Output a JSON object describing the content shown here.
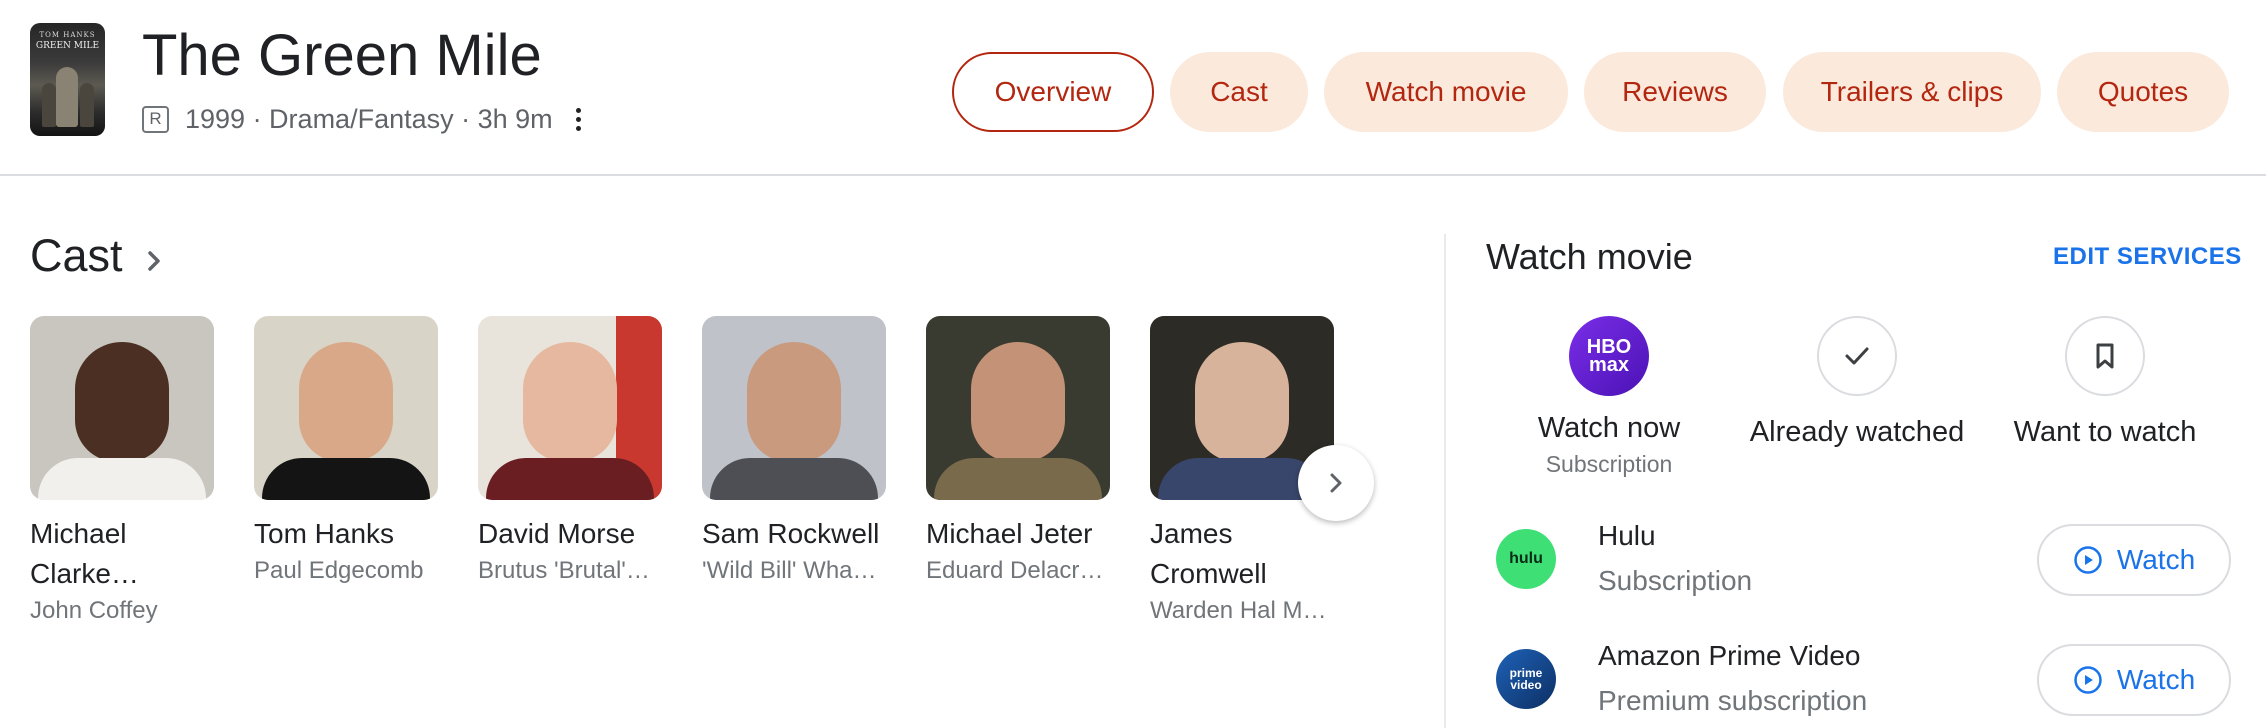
{
  "movie": {
    "title": "The Green Mile",
    "rating": "R",
    "meta": "1999 · Drama/Fantasy · 3h 9m",
    "poster_text_top": "TOM HANKS",
    "poster_text_title": "GREEN MILE"
  },
  "tabs": [
    {
      "label": "Overview",
      "active": true
    },
    {
      "label": "Cast",
      "active": false
    },
    {
      "label": "Watch movie",
      "active": false
    },
    {
      "label": "Reviews",
      "active": false
    },
    {
      "label": "Trailers & clips",
      "active": false
    },
    {
      "label": "Quotes",
      "active": false
    }
  ],
  "cast": {
    "heading": "Cast",
    "members": [
      {
        "name": "Michael Clarke…",
        "role": "John Coffey"
      },
      {
        "name": "Tom Hanks",
        "role": "Paul Edgecomb"
      },
      {
        "name": "David Morse",
        "role": "Brutus 'Brutal'…"
      },
      {
        "name": "Sam Rockwell",
        "role": "'Wild Bill' Wha…"
      },
      {
        "name": "Michael Jeter",
        "role": "Eduard Delacroix"
      },
      {
        "name": "James Cromwell",
        "role": "Warden Hal M…"
      }
    ]
  },
  "watch": {
    "heading": "Watch movie",
    "edit_label": "EDIT SERVICES",
    "hbo_logo": "HBO max",
    "options": [
      {
        "label": "Watch now",
        "sub": "Subscription"
      },
      {
        "label": "Already watched"
      },
      {
        "label": "Want to watch"
      }
    ],
    "providers": [
      {
        "name": "Hulu",
        "sub": "Subscription",
        "logo": "hulu",
        "button": "Watch"
      },
      {
        "name": "Amazon Prime Video",
        "sub": "Premium subscription",
        "logo": "prime video",
        "button": "Watch"
      }
    ]
  },
  "colors": {
    "accent": "#b3260f",
    "pill_bg": "#fbe9dc",
    "link": "#1a73e8"
  }
}
